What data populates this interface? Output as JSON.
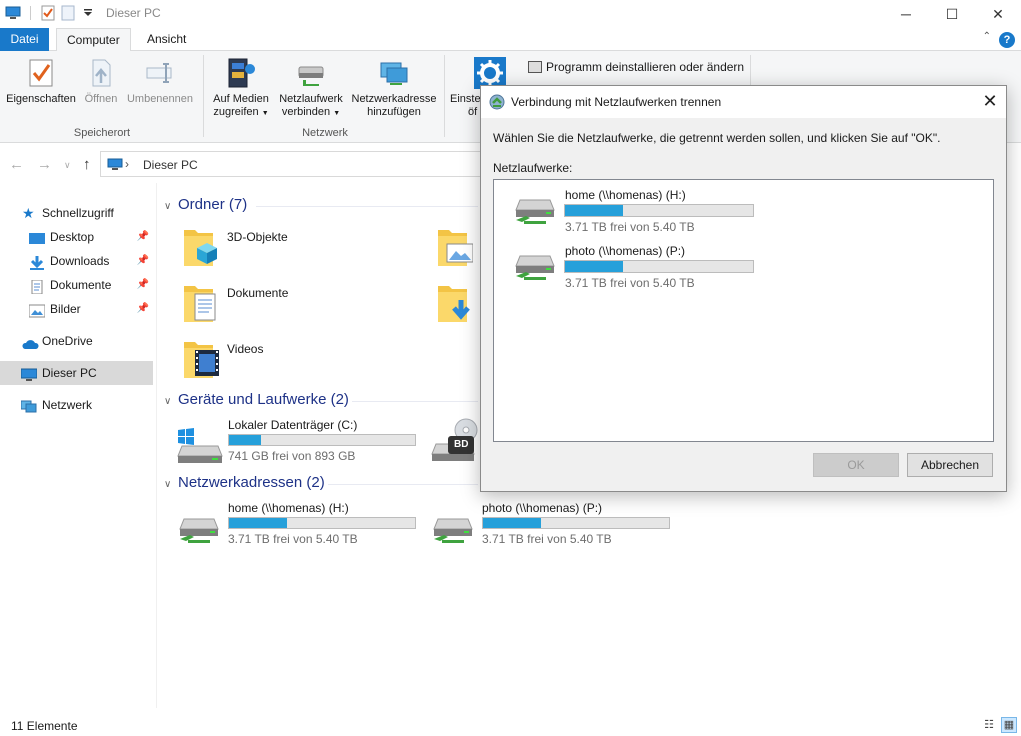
{
  "window": {
    "title": "Dieser PC",
    "minimize": "─",
    "maximize": "☐",
    "close": "✕"
  },
  "ribbon_tabs": [
    "Datei",
    "Computer",
    "Ansicht"
  ],
  "ribbon": {
    "speicherort": {
      "label": "Speicherort",
      "eigenschaften": "Eigenschaften",
      "oeffnen": "Öffnen",
      "umbenennen": "Umbenennen"
    },
    "netzwerk": {
      "label": "Netzwerk",
      "medien_1": "Auf Medien",
      "medien_2": "zugreifen",
      "laufwerk_1": "Netzlaufwerk",
      "laufwerk_2": "verbinden",
      "adresse_1": "Netzwerkadresse",
      "adresse_2": "hinzufügen"
    },
    "system": {
      "einst_1": "Einste",
      "einst_2": "öf",
      "programm": "Programm deinstallieren oder ändern"
    }
  },
  "address": {
    "crumb": "Dieser PC"
  },
  "sidebar": {
    "items": [
      {
        "label": "Schnellzugriff"
      },
      {
        "label": "Desktop"
      },
      {
        "label": "Downloads"
      },
      {
        "label": "Dokumente"
      },
      {
        "label": "Bilder"
      },
      {
        "label": "OneDrive"
      },
      {
        "label": "Dieser PC"
      },
      {
        "label": "Netzwerk"
      }
    ]
  },
  "main": {
    "ordner_header": "Ordner (7)",
    "folders": [
      {
        "label": "3D-Objekte"
      },
      {
        "label": "Dokumente"
      },
      {
        "label": "Videos"
      }
    ],
    "geraete_header": "Geräte und Laufwerke (2)",
    "local_drive": {
      "name": "Lokaler Datenträger (C:)",
      "free": "741 GB frei von 893 GB",
      "used_fraction": 0.17
    },
    "bd_label": "BD",
    "netz_header": "Netzwerkadressen (2)",
    "net_drives": [
      {
        "name": "home (\\\\homenas) (H:)",
        "free": "3.71 TB frei von 5.40 TB",
        "used_fraction": 0.31
      },
      {
        "name": "photo (\\\\homenas) (P:)",
        "free": "3.71 TB frei von 5.40 TB",
        "used_fraction": 0.31
      }
    ]
  },
  "status": {
    "count": "11 Elemente"
  },
  "dialog": {
    "title": "Verbindung mit Netzlaufwerken trennen",
    "instruction": "Wählen Sie die Netzlaufwerke, die getrennt werden sollen, und klicken Sie auf \"OK\".",
    "list_label": "Netzlaufwerke:",
    "drives": [
      {
        "name": "home (\\\\homenas) (H:)",
        "free": "3.71 TB frei von 5.40 TB",
        "used_fraction": 0.31
      },
      {
        "name": "photo (\\\\homenas) (P:)",
        "free": "3.71 TB frei von 5.40 TB",
        "used_fraction": 0.31
      }
    ],
    "ok": "OK",
    "cancel": "Abbrechen"
  },
  "colors": {
    "accent": "#1979ca",
    "bar_fill": "#26a0da",
    "section_header": "#1e3287"
  }
}
